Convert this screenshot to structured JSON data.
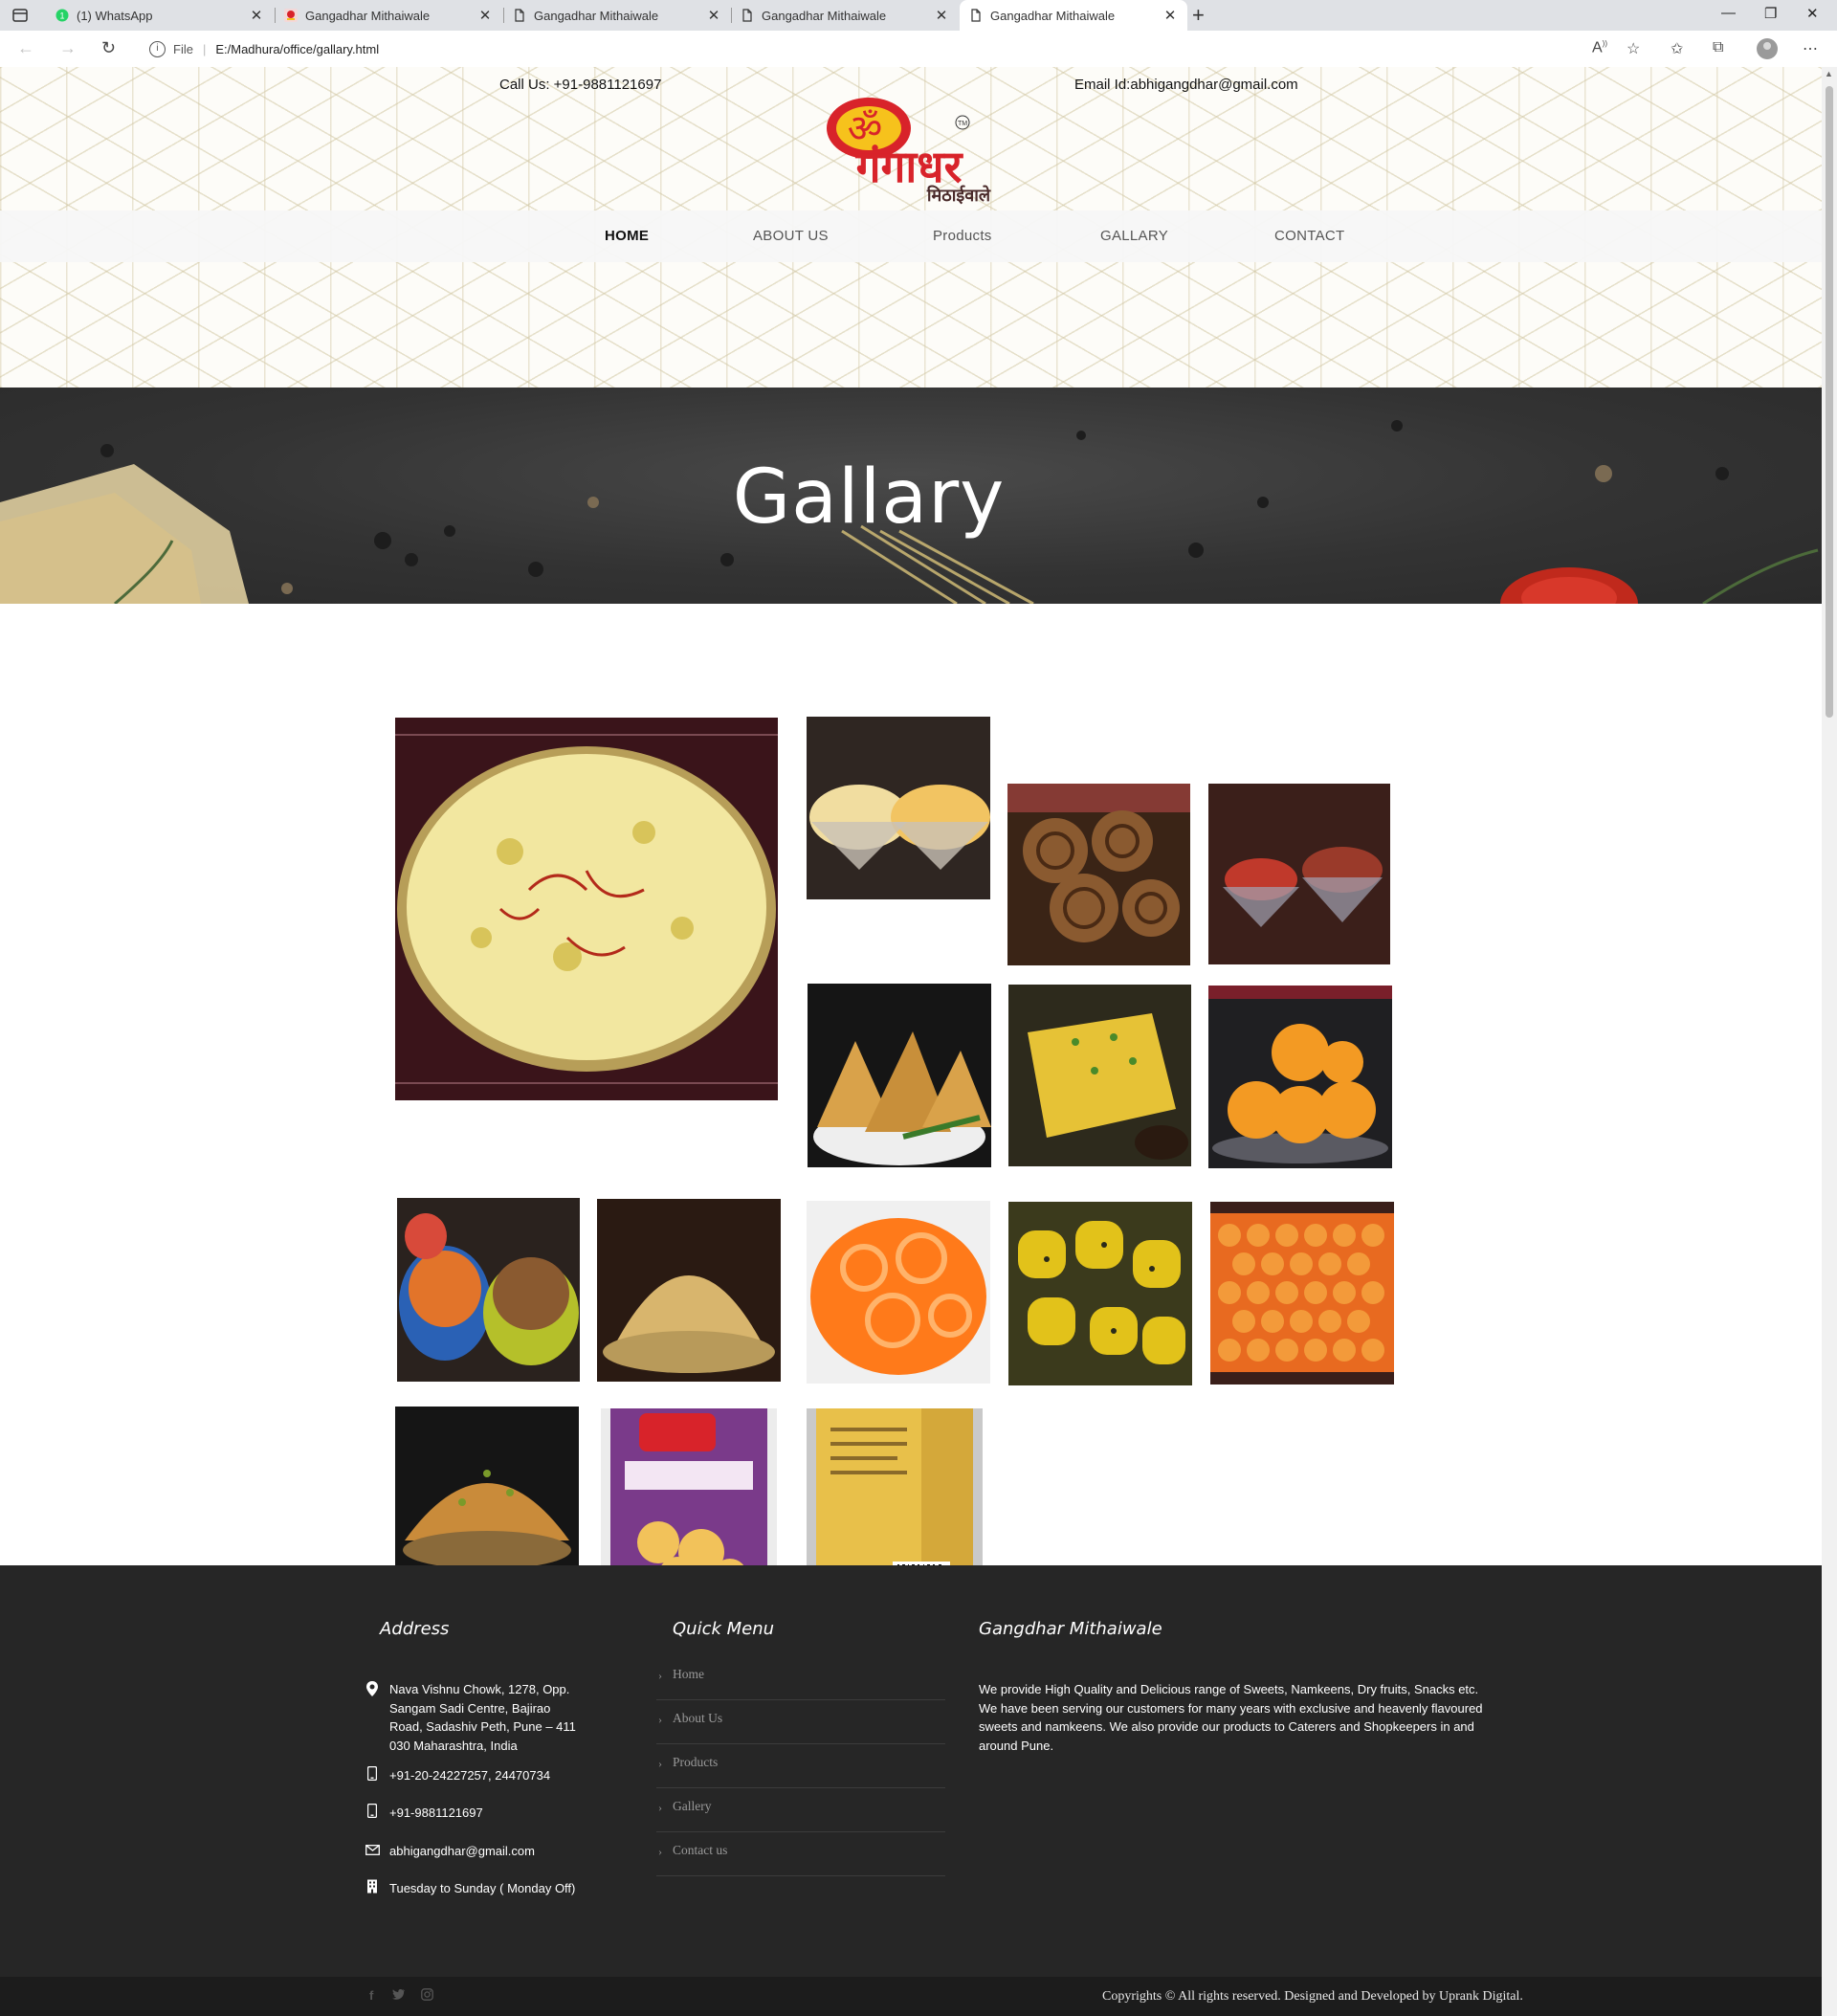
{
  "browser": {
    "tabs": [
      {
        "title": "(1) WhatsApp",
        "icon": "whatsapp-icon"
      },
      {
        "title": "Gangadhar Mithaiwale",
        "icon": "site-icon"
      },
      {
        "title": "Gangadhar Mithaiwale",
        "icon": "page-icon"
      },
      {
        "title": "Gangadhar Mithaiwale",
        "icon": "page-icon"
      },
      {
        "title": "Gangadhar Mithaiwale",
        "icon": "page-icon",
        "active": true
      }
    ],
    "address": {
      "scheme": "File",
      "url": "E:/Madhura/office/gallary.html"
    }
  },
  "header": {
    "call": "Call Us: +91-9881121697",
    "email": "Email Id:abhigangdhar@gmail.com",
    "logo": {
      "om": "ॐ",
      "name": "गंगाधर",
      "sub": "मिठाईवाले",
      "tm": "TM"
    }
  },
  "nav": [
    {
      "label": "HOME",
      "active": true
    },
    {
      "label": "ABOUT US"
    },
    {
      "label": "Products"
    },
    {
      "label": "GALLARY"
    },
    {
      "label": "CONTACT"
    }
  ],
  "banner": {
    "title": "Gallary"
  },
  "gallery": {
    "items": [
      {
        "name": "basundi",
        "colors": [
          "#f2e7a0",
          "#d8c45a"
        ]
      },
      {
        "name": "shrikhand-cups",
        "colors": [
          "#f1dda0",
          "#3a2b22"
        ]
      },
      {
        "name": "bakarwadi",
        "colors": [
          "#8a5a30",
          "#3a2416"
        ]
      },
      {
        "name": "gulab-jamun-bowls",
        "colors": [
          "#c0392b",
          "#3b1f1a"
        ]
      },
      {
        "name": "samosa",
        "colors": [
          "#d9a24a",
          "#1a1a1a"
        ]
      },
      {
        "name": "dhokla",
        "colors": [
          "#e6c236",
          "#2d2a1c"
        ]
      },
      {
        "name": "motichoor-laddoo",
        "colors": [
          "#f39a23",
          "#1f1f22"
        ]
      },
      {
        "name": "namkeen-bowls",
        "colors": [
          "#e2742a",
          "#2a61b5"
        ]
      },
      {
        "name": "sev",
        "colors": [
          "#d8b56d",
          "#2a1a12"
        ]
      },
      {
        "name": "jalebi",
        "colors": [
          "#ff7a1a",
          "#f0f0f0"
        ]
      },
      {
        "name": "khandvi",
        "colors": [
          "#e2c21a",
          "#3b3a1c"
        ]
      },
      {
        "name": "laddoo-tray",
        "colors": [
          "#f07f2b",
          "#3a1f1a"
        ]
      },
      {
        "name": "chivda",
        "colors": [
          "#c98b3a",
          "#1a1a1a"
        ]
      },
      {
        "name": "besan-laddoo-box",
        "colors": [
          "#7a3a8a",
          "#f2c25a"
        ]
      },
      {
        "name": "box-back",
        "colors": [
          "#e8c04a",
          "#c9c9c9"
        ]
      }
    ]
  },
  "footer": {
    "address": {
      "title": "Address",
      "lines": [
        "Nava Vishnu Chowk, 1278, Opp.",
        "Sangam Sadi Centre, Bajirao",
        "Road, Sadashiv Peth, Pune – 411",
        "030 Maharashtra, India"
      ],
      "phone1": "+91-20-24227257, 24470734",
      "phone2": "+91-9881121697",
      "email": "abhigangdhar@gmail.com",
      "hours": "Tuesday to Sunday ( Monday Off)"
    },
    "quick_menu": {
      "title": "Quick Menu",
      "items": [
        "Home",
        "About Us",
        "Products",
        "Gallery",
        "Contact us"
      ]
    },
    "about": {
      "title": "Gangdhar Mithaiwale",
      "text": "We provide High Quality and Delicious range of Sweets, Namkeens, Dry fruits, Snacks etc. We have been serving our customers for many years with exclusive and heavenly flavoured sweets and namkeens. We also provide our products to Caterers and Shopkeepers in and around Pune."
    },
    "copyright": "Copyrights © All rights reserved. Designed and Developed by Uprank Digital."
  },
  "colors": {
    "footer_bg": "#262626",
    "bottom_bar": "#1c1c1c",
    "logo_red": "#d8232a",
    "logo_yellow": "#f6c21c"
  }
}
